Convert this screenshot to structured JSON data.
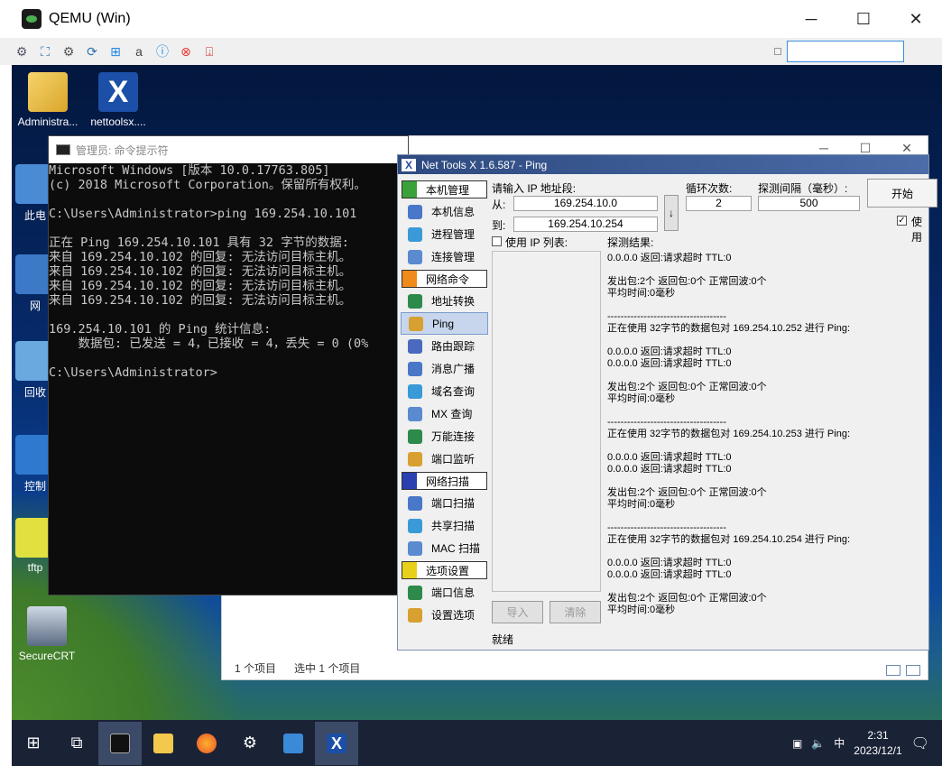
{
  "host": {
    "title": "QEMU (Win)",
    "window_controls": [
      "─",
      "☐",
      "✕"
    ]
  },
  "desktop_icons": [
    {
      "label": "Administra...",
      "icon": "user-folder-icon"
    },
    {
      "label": "nettoolsx....",
      "icon": "nettools-icon"
    },
    {
      "label": "此电",
      "icon": "computer-icon"
    },
    {
      "label": "网",
      "icon": "network-icon"
    },
    {
      "label": "回收",
      "icon": "recycle-bin-icon"
    },
    {
      "label": "控制",
      "icon": "control-panel-icon"
    },
    {
      "label": "tftp",
      "icon": "tftp-icon"
    },
    {
      "label": "SecureCRT",
      "icon": "securecrt-icon"
    }
  ],
  "cmd": {
    "title": "管理员: 命令提示符",
    "lines": [
      "Microsoft Windows [版本 10.0.17763.805]",
      "(c) 2018 Microsoft Corporation。保留所有权利。",
      "",
      "C:\\Users\\Administrator>ping 169.254.10.101",
      "",
      "正在 Ping 169.254.10.101 具有 32 字节的数据:",
      "来自 169.254.10.102 的回复: 无法访问目标主机。",
      "来自 169.254.10.102 的回复: 无法访问目标主机。",
      "来自 169.254.10.102 的回复: 无法访问目标主机。",
      "来自 169.254.10.102 的回复: 无法访问目标主机。",
      "",
      "169.254.10.101 的 Ping 统计信息:",
      "    数据包: 已发送 = 4，已接收 = 4，丢失 = 0 (0%",
      "",
      "C:\\Users\\Administrator>"
    ]
  },
  "explorer": {
    "status_count": "1 个项目",
    "status_selected": "选中 1 个项目"
  },
  "nettools": {
    "title": "Net Tools X 1.6.587 - Ping",
    "categories": [
      {
        "label": "本机管理",
        "color": "#3aa23a",
        "items": [
          {
            "label": "本机信息",
            "icon": "pc-info-icon"
          },
          {
            "label": "进程管理",
            "icon": "process-icon"
          },
          {
            "label": "连接管理",
            "icon": "connection-icon"
          }
        ]
      },
      {
        "label": "网络命令",
        "color": "#f08a1a",
        "items": [
          {
            "label": "地址转换",
            "icon": "address-convert-icon"
          },
          {
            "label": "Ping",
            "icon": "ping-icon",
            "selected": true
          },
          {
            "label": "路由跟踪",
            "icon": "traceroute-icon"
          },
          {
            "label": "消息广播",
            "icon": "broadcast-icon"
          },
          {
            "label": "域名查询",
            "icon": "dns-icon"
          },
          {
            "label": "MX 查询",
            "icon": "mx-icon"
          },
          {
            "label": "万能连接",
            "icon": "key-icon"
          },
          {
            "label": "端口监听",
            "icon": "globe-icon"
          }
        ]
      },
      {
        "label": "网络扫描",
        "color": "#2a3fb0",
        "items": [
          {
            "label": "端口扫描",
            "icon": "magnifier-icon"
          },
          {
            "label": "共享扫描",
            "icon": "share-icon"
          },
          {
            "label": "MAC 扫描",
            "icon": "mac-icon"
          }
        ]
      },
      {
        "label": "选项设置",
        "color": "#e8d01a",
        "items": [
          {
            "label": "端口信息",
            "icon": "port-info-icon"
          },
          {
            "label": "设置选项",
            "icon": "settings-icon"
          }
        ]
      }
    ],
    "ip_label": "请输入 IP 地址段:",
    "from_label": "从:",
    "from_value": "169.254.10.0",
    "to_label": "到:",
    "to_value": "169.254.10.254",
    "arrow": "↓",
    "loop_label": "循环次数:",
    "loop_value": "2",
    "interval_label": "探测间隔（毫秒）:",
    "interval_value": "500",
    "start_button": "开始",
    "use_label": "使用",
    "use_checked": "✓",
    "use_ip_list_label": "使用 IP 列表:",
    "results_label": "探测结果:",
    "import_button": "导入",
    "clear_button": "清除",
    "status": "就绪",
    "results": [
      "0.0.0.0 返回:请求超时 TTL:0",
      "",
      "发出包:2个 返回包:0个 正常回波:0个",
      "平均时间:0毫秒",
      "",
      "------------------------------------",
      "正在使用 32字节的数据包对 169.254.10.252 进行 Ping:",
      "",
      "0.0.0.0 返回:请求超时 TTL:0",
      "0.0.0.0 返回:请求超时 TTL:0",
      "",
      "发出包:2个 返回包:0个 正常回波:0个",
      "平均时间:0毫秒",
      "",
      "------------------------------------",
      "正在使用 32字节的数据包对 169.254.10.253 进行 Ping:",
      "",
      "0.0.0.0 返回:请求超时 TTL:0",
      "0.0.0.0 返回:请求超时 TTL:0",
      "",
      "发出包:2个 返回包:0个 正常回波:0个",
      "平均时间:0毫秒",
      "",
      "------------------------------------",
      "正在使用 32字节的数据包对 169.254.10.254 进行 Ping:",
      "",
      "0.0.0.0 返回:请求超时 TTL:0",
      "0.0.0.0 返回:请求超时 TTL:0",
      "",
      "发出包:2个 返回包:0个 正常回波:0个",
      "平均时间:0毫秒"
    ]
  },
  "taskbar": {
    "apps": [
      {
        "name": "start-button",
        "glyph": "⊞"
      },
      {
        "name": "task-view",
        "glyph": "⧉"
      },
      {
        "name": "cmd",
        "glyph": "▭"
      },
      {
        "name": "file-explorer",
        "glyph": "▬"
      },
      {
        "name": "firefox",
        "glyph": "●"
      },
      {
        "name": "settings",
        "glyph": "⚙"
      },
      {
        "name": "control-panel",
        "glyph": "▦"
      },
      {
        "name": "nettools",
        "glyph": "X"
      }
    ],
    "ime": "中",
    "time": "2:31",
    "date": "2023/12/1"
  }
}
